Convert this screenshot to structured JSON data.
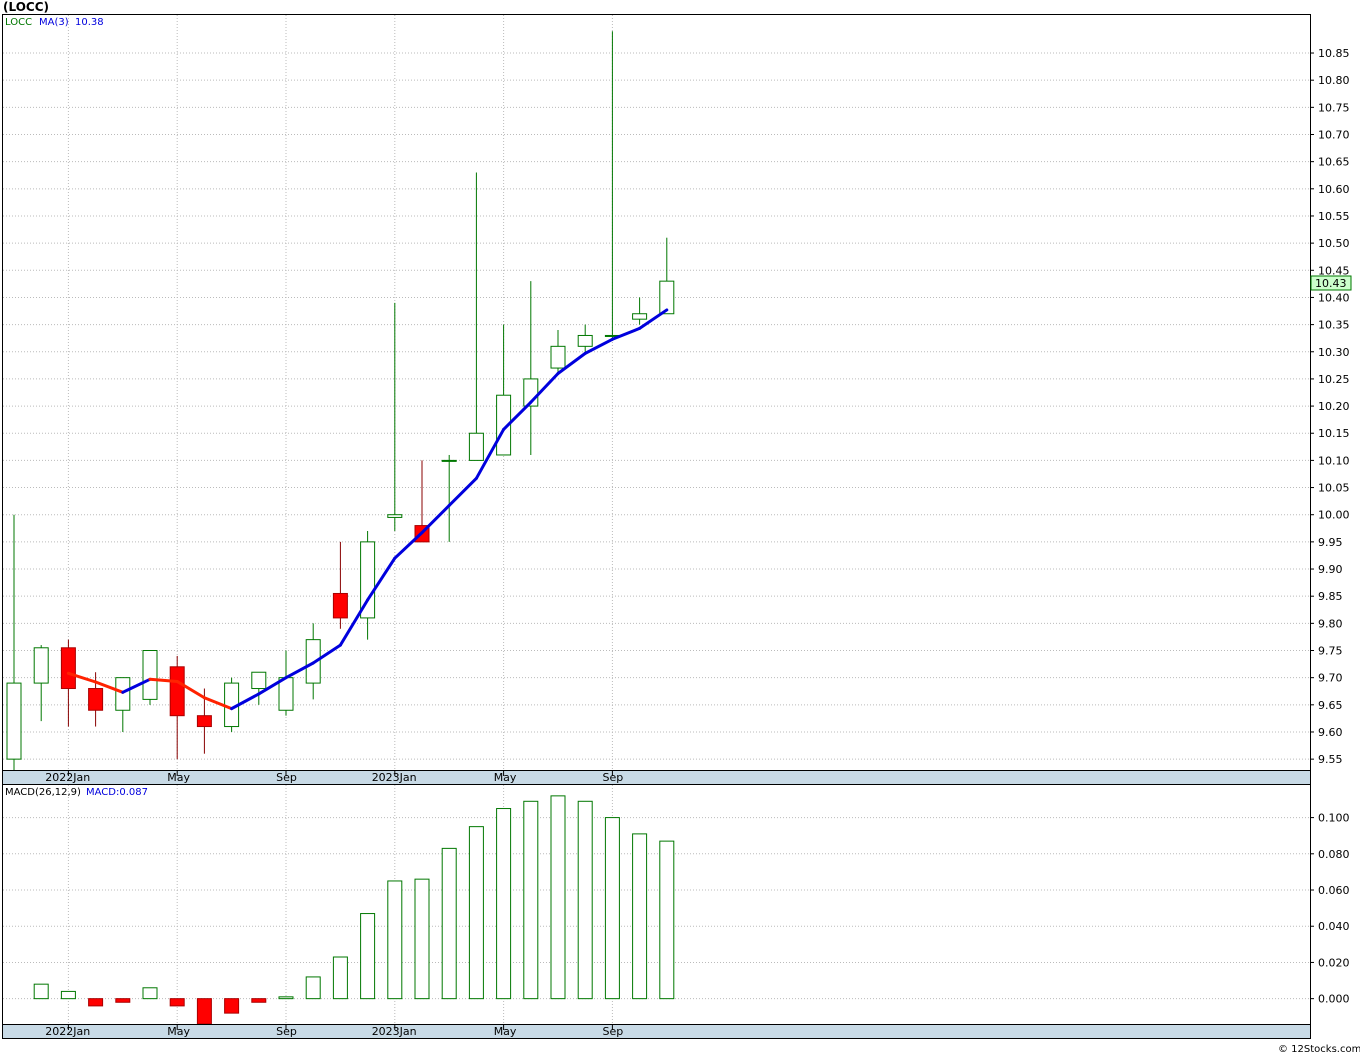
{
  "header": {
    "symbol": "(LOCC)",
    "footer": "© 12Stocks.com"
  },
  "price_panel": {
    "legend": {
      "ticker": "LOCC",
      "ma_label": "MA(3)",
      "ma_value": "10.38"
    },
    "last_price": "10.43",
    "y_ticks": [
      "9.55",
      "9.60",
      "9.65",
      "9.70",
      "9.75",
      "9.80",
      "9.85",
      "9.90",
      "9.95",
      "10.00",
      "10.05",
      "10.10",
      "10.15",
      "10.20",
      "10.25",
      "10.30",
      "10.35",
      "10.40",
      "10.45",
      "10.50",
      "10.55",
      "10.60",
      "10.65",
      "10.70",
      "10.75",
      "10.80",
      "10.85"
    ],
    "x_labels": [
      "2022Jan",
      "May",
      "Sep",
      "2023Jan",
      "May",
      "Sep"
    ]
  },
  "macd_panel": {
    "legend": {
      "label": "MACD(26,12,9)",
      "value_label": "MACD:0.087"
    },
    "y_ticks": [
      "0.000",
      "0.020",
      "0.040",
      "0.060",
      "0.080",
      "0.100"
    ],
    "x_labels": [
      "2022Jan",
      "May",
      "Sep",
      "2023Jan",
      "May",
      "Sep"
    ]
  },
  "colors": {
    "up": "#007700",
    "down": "#ff0000",
    "ma_up": "#0000dd",
    "ma_down": "#ff2200",
    "grid": "#bbbbbb",
    "axis_band": "#c8dae6",
    "last_price_bg": "#ccffcc"
  },
  "chart_data": [
    {
      "type": "candlestick",
      "title": "(LOCC)",
      "interval": "monthly",
      "ylim": [
        9.53,
        10.92
      ],
      "x": [
        "2021-11",
        "2021-12",
        "2022-01",
        "2022-02",
        "2022-03",
        "2022-04",
        "2022-05",
        "2022-06",
        "2022-07",
        "2022-08",
        "2022-09",
        "2022-10",
        "2022-11",
        "2022-12",
        "2023-01",
        "2023-02",
        "2023-03",
        "2023-04",
        "2023-05",
        "2023-06",
        "2023-07",
        "2023-08",
        "2023-09",
        "2023-10",
        "2023-11",
        "2023-12"
      ],
      "series": [
        {
          "name": "LOCC",
          "open": [
            9.55,
            9.69,
            9.755,
            9.68,
            9.64,
            9.66,
            9.72,
            9.63,
            9.61,
            9.68,
            9.64,
            9.69,
            9.855,
            9.81,
            9.995,
            9.98,
            10.1,
            10.1,
            10.11,
            10.2,
            10.27,
            10.31,
            10.33,
            10.36,
            10.37,
            null
          ],
          "high": [
            10.0,
            9.76,
            9.77,
            9.71,
            9.7,
            9.75,
            9.74,
            9.68,
            9.7,
            9.71,
            9.75,
            9.8,
            9.95,
            9.97,
            10.39,
            10.1,
            10.11,
            10.63,
            10.35,
            10.43,
            10.34,
            10.35,
            10.89,
            10.4,
            10.51,
            null
          ],
          "low": [
            9.53,
            9.62,
            9.61,
            9.61,
            9.6,
            9.65,
            9.55,
            9.56,
            9.6,
            9.65,
            9.63,
            9.66,
            9.79,
            9.77,
            9.97,
            9.95,
            9.95,
            10.1,
            10.11,
            10.11,
            10.26,
            10.3,
            10.32,
            10.35,
            10.37,
            null
          ],
          "close": [
            9.69,
            9.755,
            9.68,
            9.64,
            9.7,
            9.75,
            9.63,
            9.61,
            9.69,
            9.71,
            9.7,
            9.77,
            9.81,
            9.95,
            10.0,
            9.95,
            10.1,
            10.15,
            10.22,
            10.25,
            10.31,
            10.33,
            10.33,
            10.37,
            10.43,
            null
          ]
        },
        {
          "name": "MA(3)",
          "type": "line",
          "values": [
            null,
            null,
            9.708,
            9.692,
            9.673,
            9.697,
            9.693,
            9.663,
            9.643,
            9.67,
            9.7,
            9.727,
            9.76,
            9.843,
            9.92,
            9.967,
            10.017,
            10.067,
            10.157,
            10.207,
            10.26,
            10.297,
            10.323,
            10.343,
            10.377,
            null
          ]
        }
      ]
    },
    {
      "type": "bar",
      "title": "MACD(26,12,9)",
      "ylim": [
        -0.014,
        0.118
      ],
      "x": [
        "2021-11",
        "2021-12",
        "2022-01",
        "2022-02",
        "2022-03",
        "2022-04",
        "2022-05",
        "2022-06",
        "2022-07",
        "2022-08",
        "2022-09",
        "2022-10",
        "2022-11",
        "2022-12",
        "2023-01",
        "2023-02",
        "2023-03",
        "2023-04",
        "2023-05",
        "2023-06",
        "2023-07",
        "2023-08",
        "2023-09",
        "2023-10",
        "2023-11",
        "2023-12"
      ],
      "series": [
        {
          "name": "MACD",
          "values": [
            null,
            0.008,
            0.004,
            -0.004,
            -0.002,
            0.006,
            -0.004,
            -0.014,
            -0.008,
            -0.002,
            0.001,
            0.012,
            0.023,
            0.047,
            0.065,
            0.066,
            0.083,
            0.095,
            0.105,
            0.109,
            0.112,
            0.109,
            0.1,
            0.091,
            0.087,
            null
          ]
        }
      ]
    }
  ]
}
